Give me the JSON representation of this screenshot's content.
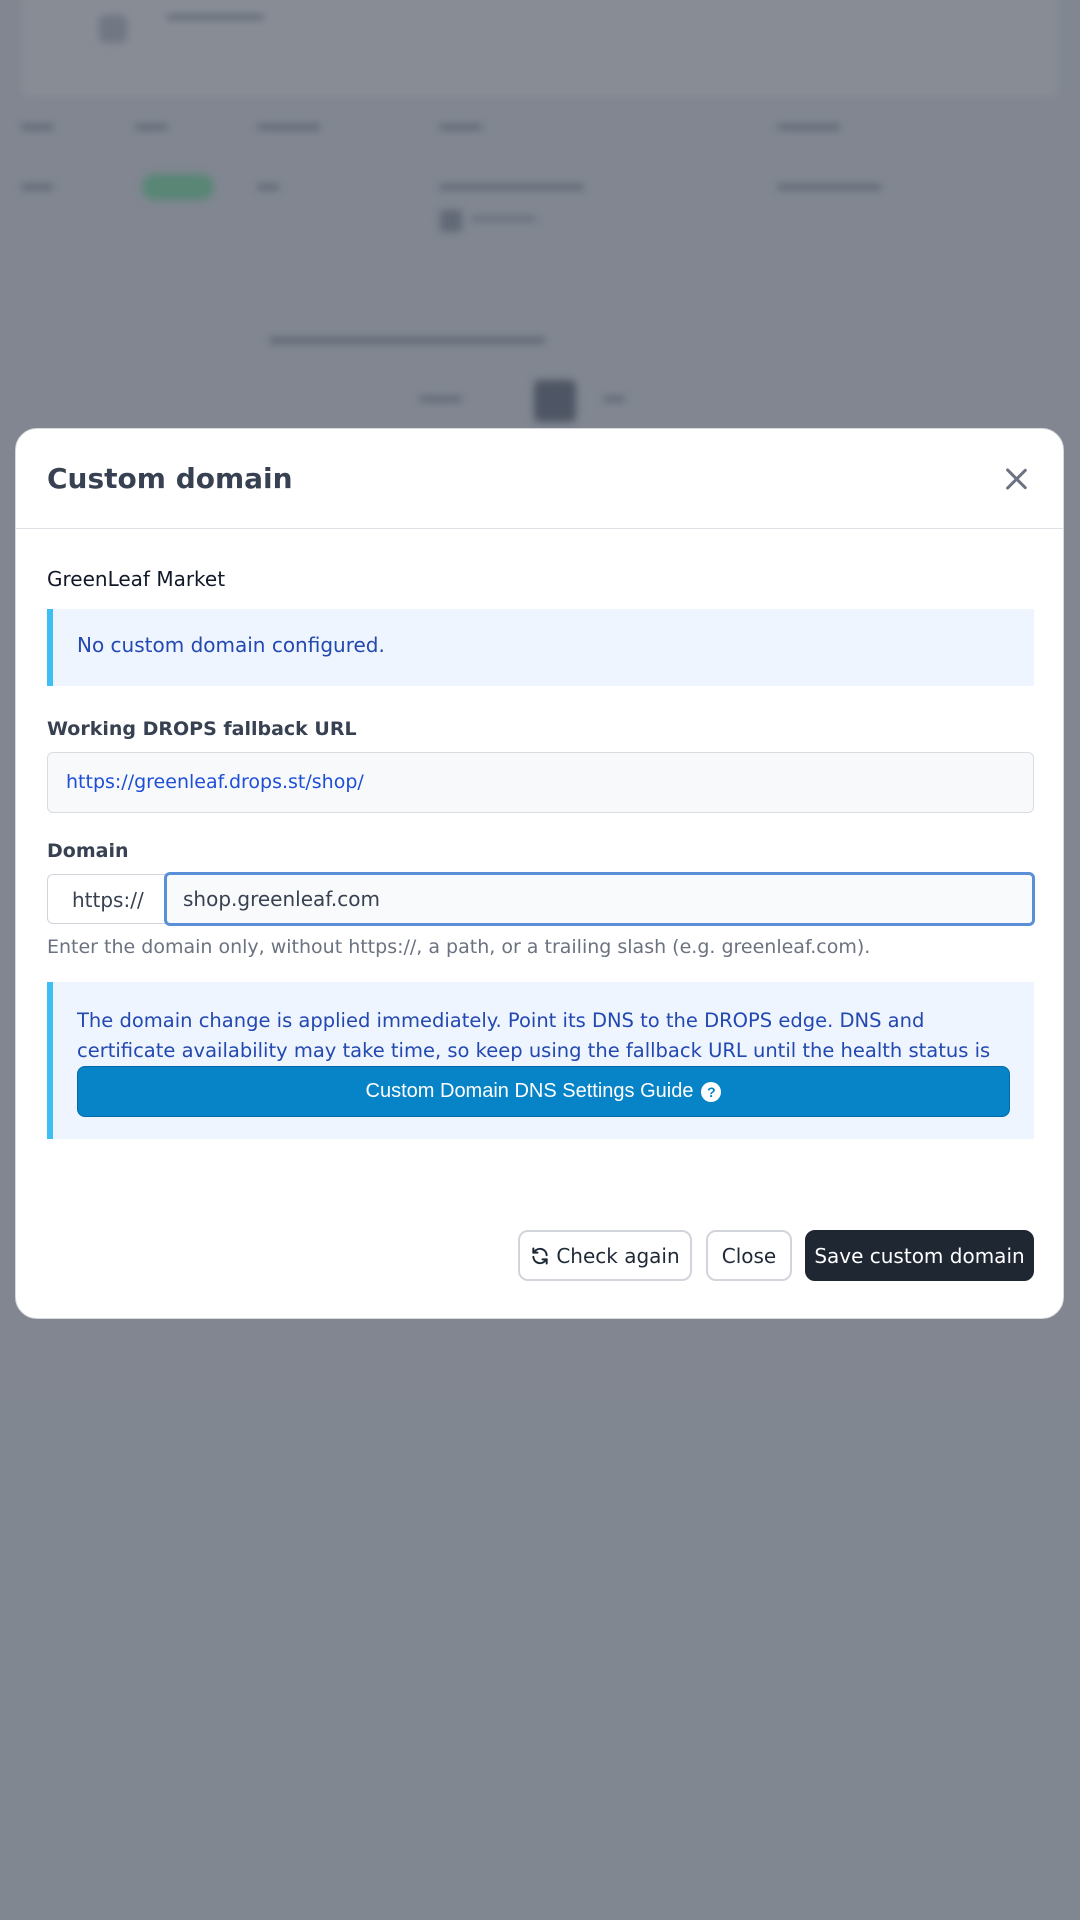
{
  "modal": {
    "title": "Custom domain",
    "shop_name": "GreenLeaf Market",
    "no_domain_notice": "No custom domain configured.",
    "fallback": {
      "label": "Working DROPS fallback URL",
      "url": "https://greenleaf.drops.st/shop/"
    },
    "domain": {
      "label": "Domain",
      "prefix": "https://",
      "value": "shop.greenleaf.com",
      "help": "Enter the domain only, without https://, a path, or a trailing slash (e.g. greenleaf.com)."
    },
    "info": {
      "text": "The domain change is applied immediately. Point its DNS to the DROPS edge. DNS and certificate availability may take time, so keep using the fallback URL until the health status is green.",
      "guide_button": "Custom Domain DNS Settings Guide",
      "guide_icon": "question-circle-icon"
    },
    "buttons": {
      "check_again": "Check again",
      "close": "Close",
      "save": "Save custom domain"
    }
  },
  "colors": {
    "info_accent": "#3fbef3",
    "info_bg": "#eef5fe",
    "info_text": "#2348b0",
    "guide_button": "#0783c8",
    "save_button": "#1f2733",
    "input_focus": "#5b8fd8"
  }
}
